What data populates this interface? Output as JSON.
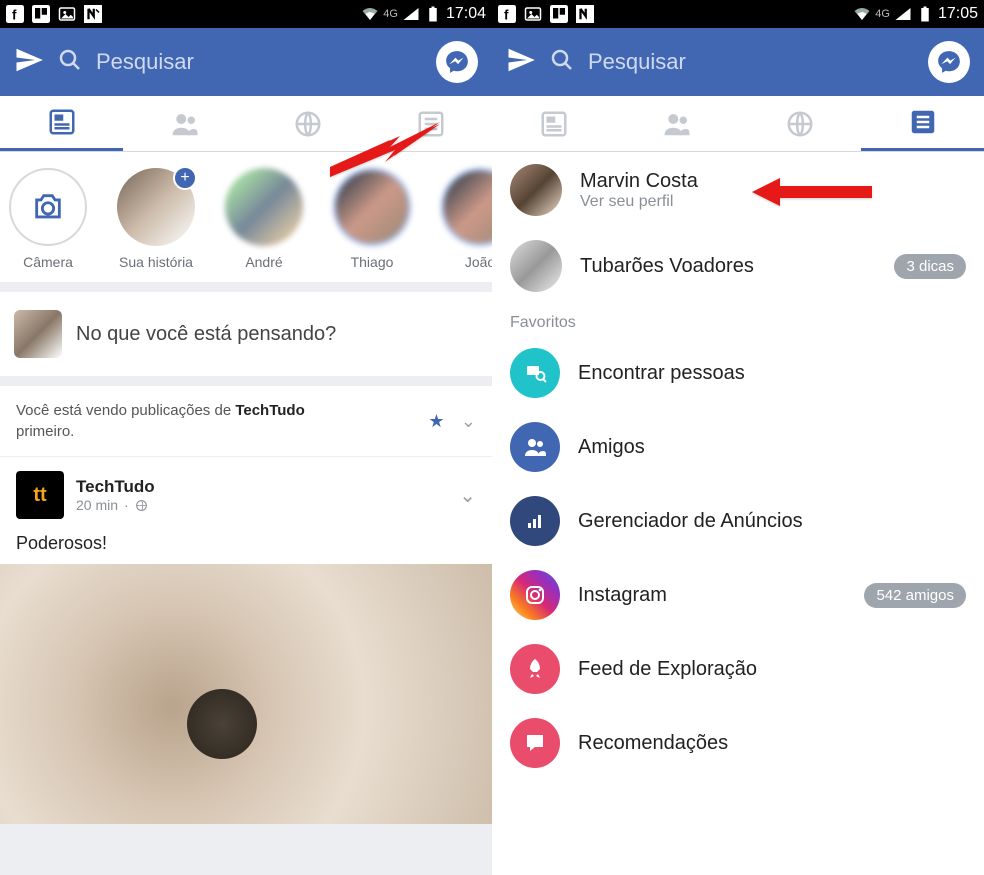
{
  "status": {
    "left_time": "17:04",
    "right_time": "17:05",
    "network_label": "4G"
  },
  "header": {
    "search_placeholder": "Pesquisar"
  },
  "stories": {
    "camera_label": "Câmera",
    "own_label": "Sua história",
    "items": [
      "André",
      "Thiago",
      "João"
    ]
  },
  "composer": {
    "prompt": "No que você está pensando?"
  },
  "feed_hint": {
    "prefix": "Você está vendo publicações de ",
    "bold": "TechTudo",
    "suffix": "primeiro."
  },
  "post": {
    "page_name": "TechTudo",
    "logo_text": "tt",
    "time": "20 min",
    "body": "Poderosos!"
  },
  "menu": {
    "profile_name": "Marvin Costa",
    "profile_sub": "Ver seu perfil",
    "page_name": "Tubarões Voadores",
    "page_badge": "3 dicas",
    "section": "Favoritos",
    "items": {
      "find": "Encontrar pessoas",
      "friends": "Amigos",
      "ads": "Gerenciador de Anúncios",
      "instagram": "Instagram",
      "instagram_badge": "542 amigos",
      "explore": "Feed de Exploração",
      "recs": "Recomendações"
    }
  }
}
